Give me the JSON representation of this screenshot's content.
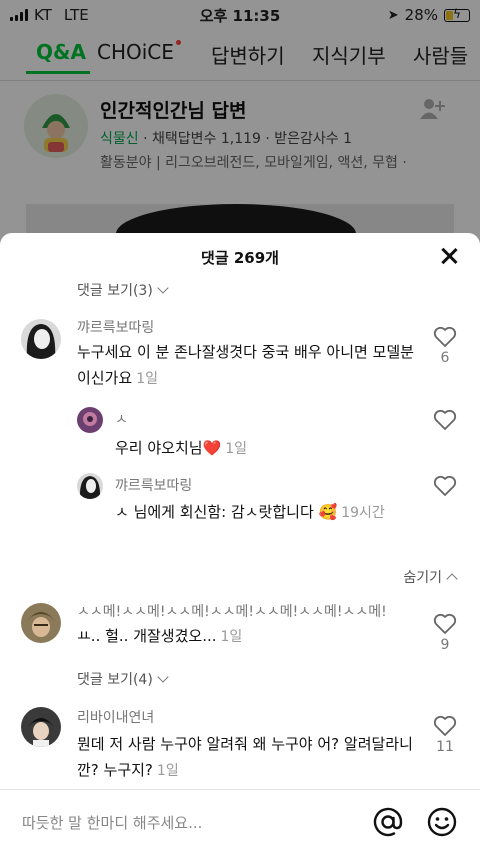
{
  "status": {
    "carrier": "KT",
    "network": "LTE",
    "time": "오후 11:35",
    "battery": "28%"
  },
  "nav": {
    "tabs": [
      "Q&A",
      "CHOiCE",
      "답변하기",
      "지식기부",
      "사람들"
    ]
  },
  "profile": {
    "name": "인간적인간님 답변",
    "rank": "식물신",
    "stats": "· 채택답변수 1,119 · 받은감사수 1",
    "area": "활동분야 | 리그오브레전드, 모바일게임, 액션, 무협  ·"
  },
  "sheet": {
    "title": "댓글 269개",
    "compose_placeholder": "따듯한 말 한마디 해주세요..."
  },
  "threads": [
    {
      "view_more": "댓글 보기(3)",
      "user": "꺄르륵보따링",
      "text": "누구세요 이 분 존나잘생겻다 중국 배우 아니면 모델분이신가요",
      "time": "1일",
      "likes": "6",
      "replies": [
        {
          "user": "ㅅ",
          "text": "우리 야오치님❤️",
          "time": "1일"
        },
        {
          "user": "꺄르륵보따링",
          "text": "ㅅ 님에게 회신함: 감ㅅ랏합니다 🥰",
          "time": "19시간"
        }
      ],
      "collapse": "숨기기"
    },
    {
      "user": "ㅅㅅ메!ㅅㅅ메!ㅅㅅ메!ㅅㅅ메!ㅅㅅ메!ㅅㅅ메!ㅅㅅ메!",
      "text": "ㅛ.. 헐.. 개잘생겼오...",
      "time": "1일",
      "likes": "9",
      "view_more": "댓글 보기(4)"
    },
    {
      "user": "리바이내연녀",
      "text": "뭔데 저 사람 누구야 알려줘 왜 누구야 어? 알려달라니깐? 누구지?",
      "time": "1일",
      "likes": "11"
    }
  ],
  "icons": [
    "back-icon",
    "add-friend-icon",
    "close-icon",
    "chevron-down-icon",
    "chevron-up-icon",
    "heart-icon",
    "at-icon",
    "emoji-icon"
  ],
  "colors": {
    "accent": "#00c73c",
    "reply_heart": "#e0242a"
  }
}
